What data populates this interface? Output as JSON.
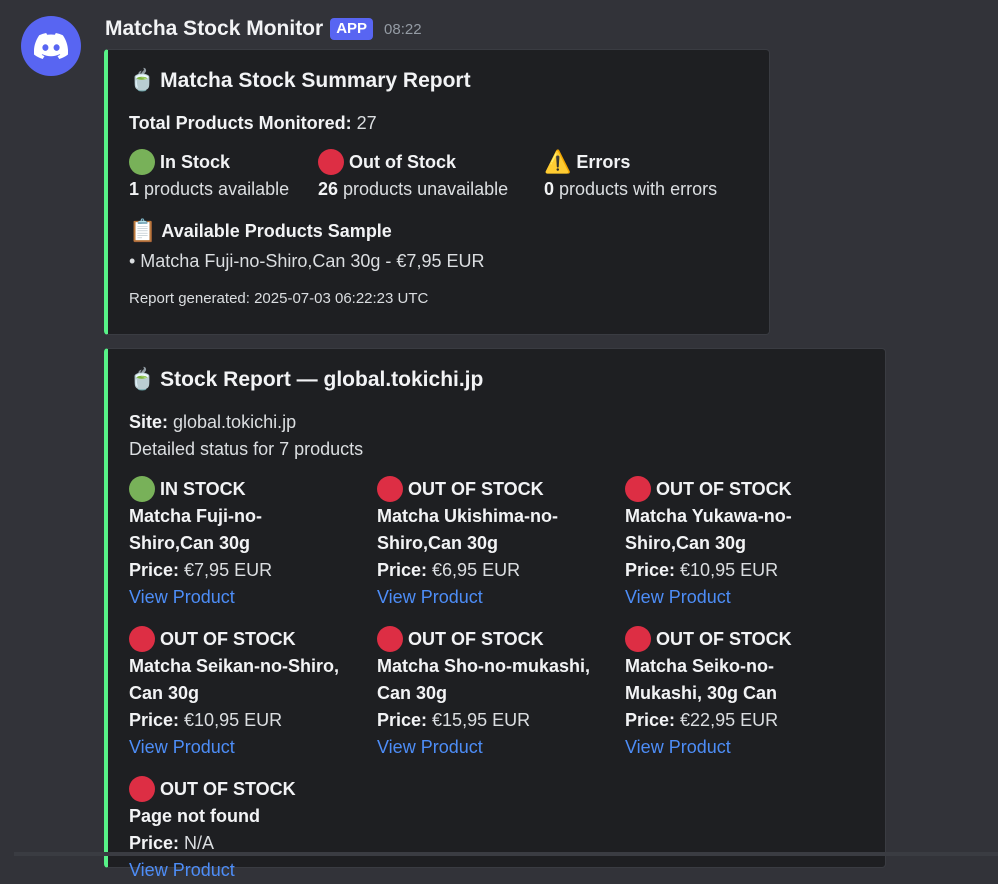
{
  "message": {
    "author": "Matcha Stock Monitor",
    "badge": "APP",
    "time": "08:22",
    "avatar_icon": "discord-logo-icon",
    "accent_color": "#57f287"
  },
  "summary": {
    "title_icon": "🍵",
    "title": "Matcha Stock Summary Report",
    "total_label": "Total Products Monitored:",
    "total_value": "27",
    "in_stock": {
      "label": "In Stock",
      "count": "1",
      "suffix": " products available"
    },
    "out_of_stock": {
      "label": "Out of Stock",
      "count": "26",
      "suffix": " products unavailable"
    },
    "errors": {
      "label": "Errors",
      "count": "0",
      "suffix": " products with errors",
      "icon": "⚠️"
    },
    "sample_icon": "📋",
    "sample_title": "Available Products Sample",
    "sample_item": "• Matcha Fuji-no-Shiro,Can 30g - €7,95 EUR",
    "footer": "Report generated: 2025-07-03 06:22:23 UTC"
  },
  "report": {
    "title_icon": "🍵",
    "title": "Stock Report — global.tokichi.jp",
    "site_label": "Site:",
    "site_value": " global.tokichi.jp",
    "detail": "Detailed status for 7 products",
    "price_label": "Price:",
    "link_label": "View Product",
    "products": [
      {
        "status": "IN STOCK",
        "name1": "Matcha Fuji-no-",
        "name2": "Shiro,Can 30g",
        "price": " €7,95 EUR"
      },
      {
        "status": "OUT OF STOCK",
        "name1": "Matcha Ukishima-no-",
        "name2": "Shiro,Can 30g",
        "price": " €6,95 EUR"
      },
      {
        "status": "OUT OF STOCK",
        "name1": "Matcha Yukawa-no-",
        "name2": "Shiro,Can 30g",
        "price": " €10,95 EUR"
      },
      {
        "status": "OUT OF STOCK",
        "name1": "Matcha Seikan-no-Shiro,",
        "name2": "Can 30g",
        "price": " €10,95 EUR"
      },
      {
        "status": "OUT OF STOCK",
        "name1": "Matcha Sho-no-mukashi,",
        "name2": "Can 30g",
        "price": " €15,95 EUR"
      },
      {
        "status": "OUT OF STOCK",
        "name1": "Matcha Seiko-no-",
        "name2": "Mukashi, 30g Can",
        "price": " €22,95 EUR"
      },
      {
        "status": "OUT OF STOCK",
        "name1": "Page not found",
        "name2": "",
        "price": " N/A"
      }
    ]
  }
}
